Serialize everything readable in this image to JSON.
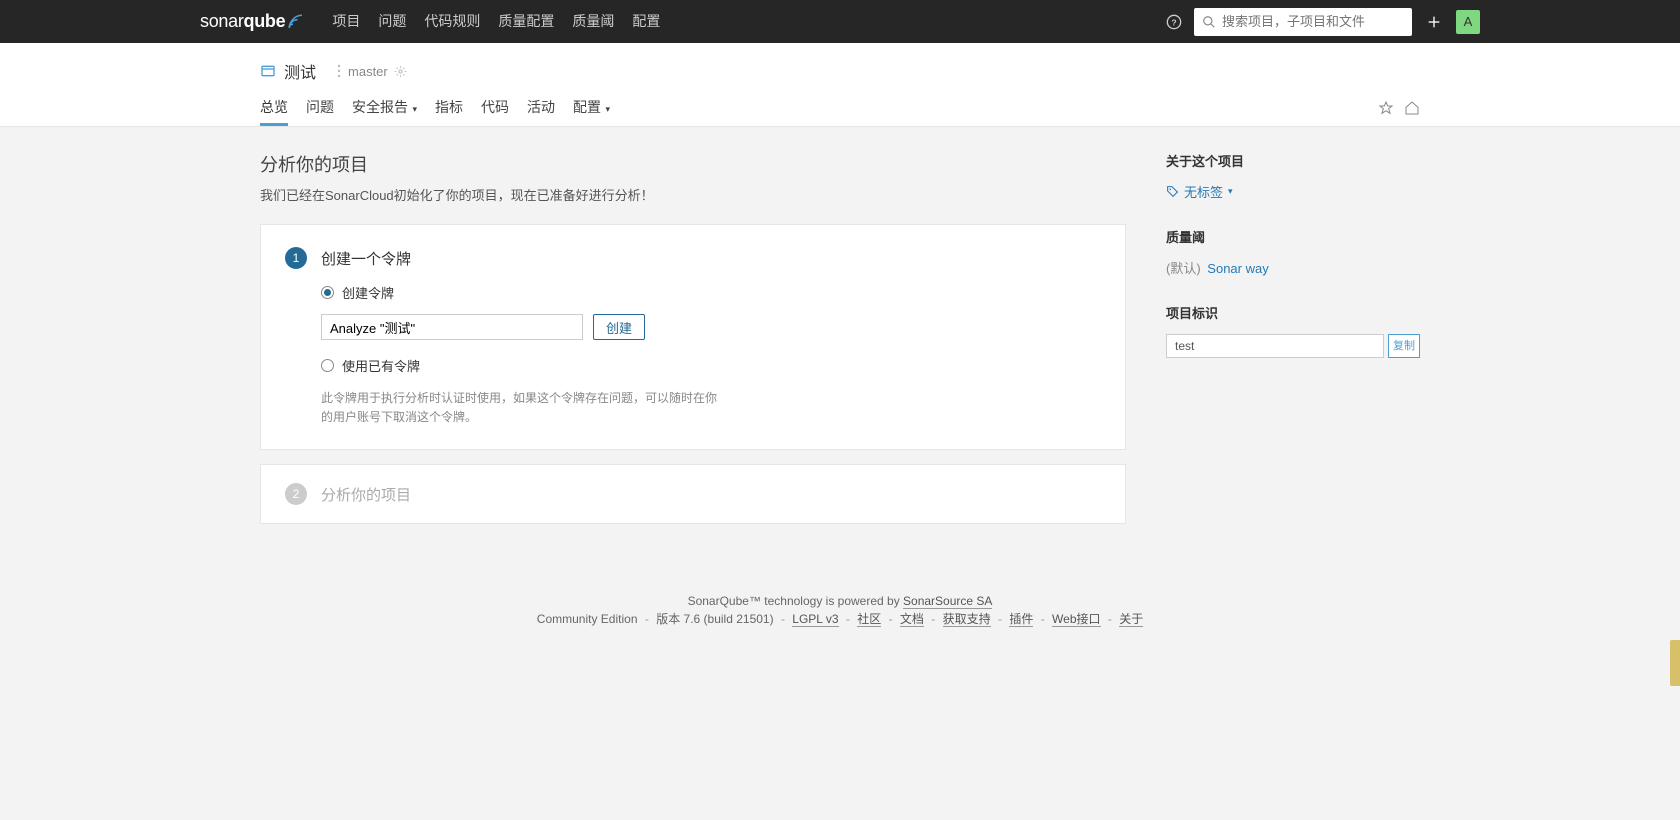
{
  "topnav": {
    "logo_plain": "sonar",
    "logo_bold": "qube",
    "items": [
      "项目",
      "问题",
      "代码规则",
      "质量配置",
      "质量阈",
      "配置"
    ],
    "search_placeholder": "搜索项目，子项目和文件",
    "avatar_letter": "A"
  },
  "project_header": {
    "name": "测试",
    "branch": "master",
    "tabs": {
      "overview": "总览",
      "issues": "问题",
      "security": "安全报告",
      "measures": "指标",
      "code": "代码",
      "activity": "活动",
      "config": "配置"
    }
  },
  "analyze": {
    "title": "分析你的项目",
    "subtitle": "我们已经在SonarCloud初始化了你的项目，现在已准备好进行分析！",
    "step1": {
      "badge": "1",
      "title": "创建一个令牌",
      "radio_create": "创建令牌",
      "radio_existing": "使用已有令牌",
      "input_value": "Analyze \"测试\"",
      "create_btn": "创建",
      "hint": "此令牌用于执行分析时认证时使用，如果这个令牌存在问题，可以随时在你的用户账号下取消这个令牌。"
    },
    "step2": {
      "badge": "2",
      "title": "分析你的项目"
    }
  },
  "sidebar": {
    "about_h": "关于这个项目",
    "tags_label": "无标签",
    "gate_h": "质量阈",
    "gate_default_prefix": "(默认)",
    "gate_link": "Sonar way",
    "key_h": "项目标识",
    "key_value": "test",
    "copy_btn": "复制"
  },
  "footer": {
    "line1_prefix": "SonarQube™ technology is powered by ",
    "line1_link": "SonarSource SA",
    "edition": "Community Edition",
    "version": "版本 7.6 (build 21501)",
    "license": "LGPL v3",
    "links": [
      "社区",
      "文档",
      "获取支持",
      "插件",
      "Web接口",
      "关于"
    ]
  }
}
